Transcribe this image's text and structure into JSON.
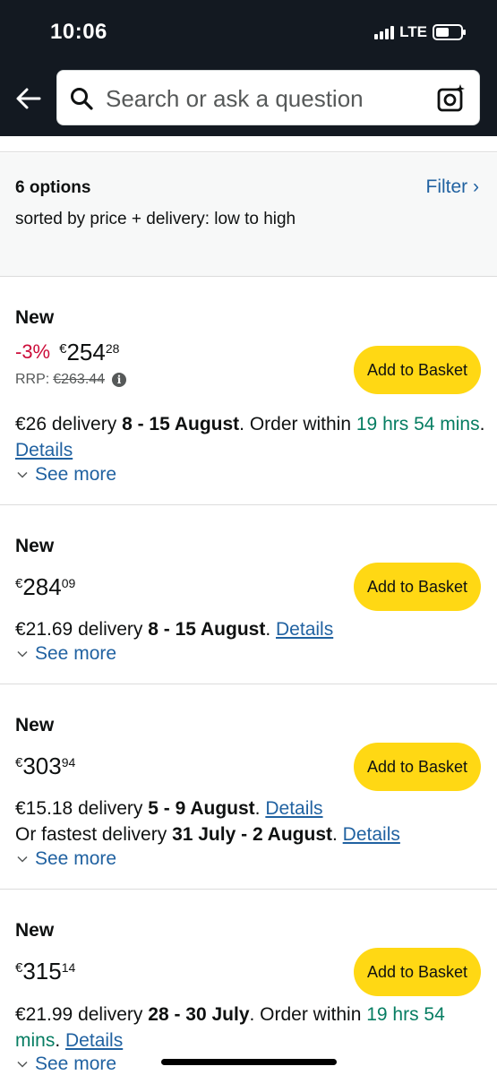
{
  "status_bar": {
    "time": "10:06",
    "network": "LTE"
  },
  "search": {
    "placeholder": "Search or ask a question"
  },
  "summary": {
    "count": "6 options",
    "sort_text": "sorted by price + delivery: low to high",
    "filter_label": "Filter ›"
  },
  "offers": [
    {
      "condition": "New",
      "discount": "-3%",
      "currency": "€",
      "price_whole": "254",
      "price_fraction": "28",
      "rrp_label": "RRP:",
      "rrp_value": "€263.44",
      "button": "Add to Basket",
      "delivery_cost": "€26 delivery ",
      "delivery_dates": "8 - 15 August",
      "order_within_label": ". Order within ",
      "order_within": "19 hrs 54 mins",
      "details": "Details",
      "see_more": "See more"
    },
    {
      "condition": "New",
      "currency": "€",
      "price_whole": "284",
      "price_fraction": "09",
      "button": "Add to Basket",
      "delivery_cost": "€21.69 delivery ",
      "delivery_dates": "8 - 15 August",
      "details": "Details",
      "see_more": "See more"
    },
    {
      "condition": "New",
      "currency": "€",
      "price_whole": "303",
      "price_fraction": "94",
      "button": "Add to Basket",
      "delivery_cost": "€15.18 delivery ",
      "delivery_dates": "5 - 9 August",
      "details": "Details",
      "fastest_label": "Or fastest delivery ",
      "fastest_dates": "31 July - 2 August",
      "fastest_details": "Details",
      "see_more": "See more"
    },
    {
      "condition": "New",
      "currency": "€",
      "price_whole": "315",
      "price_fraction": "14",
      "button": "Add to Basket",
      "delivery_cost": "€21.99 delivery ",
      "delivery_dates": "28 - 30 July",
      "order_within_label": ". Order within ",
      "order_within": "19 hrs 54 mins",
      "details": "Details",
      "see_more": "See more"
    }
  ],
  "colors": {
    "header_bg": "#131921",
    "button_yellow": "#ffd814",
    "link_blue": "#2162a1",
    "discount_red": "#cc0c39",
    "green": "#067d62"
  },
  "icons": [
    "back-arrow-icon",
    "search-icon",
    "camera-icon",
    "info-icon",
    "chevron-down-icon"
  ]
}
